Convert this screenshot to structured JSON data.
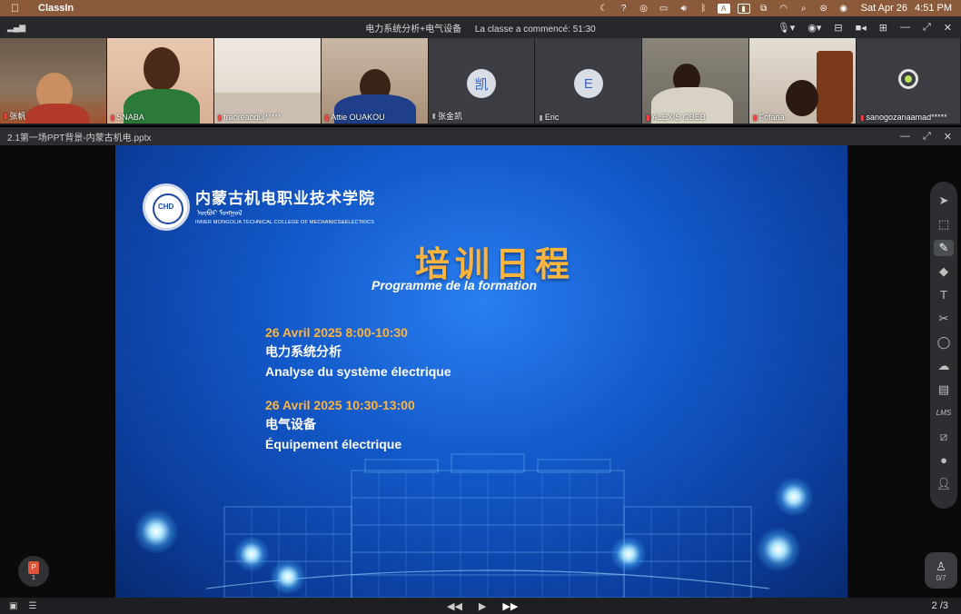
{
  "menubar": {
    "app_name": "ClassIn",
    "date": "Sat Apr 26",
    "time": "4:51 PM"
  },
  "classbar": {
    "course_title": "电力系统分析+电气设备",
    "elapsed": "La classe a commencé: 51:30"
  },
  "participants": [
    {
      "name": "张帆",
      "type": "video"
    },
    {
      "name": "SNABA",
      "type": "video"
    },
    {
      "name": "traoreabdul*****",
      "type": "video"
    },
    {
      "name": "Attie OUAKOU",
      "type": "video"
    },
    {
      "name": "张金凯",
      "type": "avatar",
      "initial": "凯"
    },
    {
      "name": "Eric",
      "type": "avatar",
      "initial": "E"
    },
    {
      "name": "ALEXIS GBEB",
      "type": "video"
    },
    {
      "name": "Fofana",
      "type": "video"
    },
    {
      "name": "sanogozanaamad*****",
      "type": "camera-off"
    }
  ],
  "document": {
    "file_name": "2.1第一场PPT背景-内蒙古机电.pptx"
  },
  "slide": {
    "school_name_zh": "内蒙古机电职业技术学院",
    "school_name_mn": "ᠥᠪᠦᠷ ᠮᠣᠩᠭᠣᠯ",
    "school_name_en": "INNER MONGOLIA TECHNICAL COLLEGE OF MECHANICS&ELECTRICS",
    "title": "培训日程",
    "subtitle": "Programme de la formation",
    "sessions": [
      {
        "when": "26 Avril 2025   8:00-10:30",
        "zh": "电力系统分析",
        "fr": "Analyse du système électrique"
      },
      {
        "when": "26 Avril 2025  10:30-13:00",
        "zh": "电气设备",
        "fr": "Équipement électrique"
      }
    ]
  },
  "ppt_badge": {
    "count": "1"
  },
  "seat_badge": {
    "count": "0/7"
  },
  "pager": {
    "current": "2 /3"
  }
}
